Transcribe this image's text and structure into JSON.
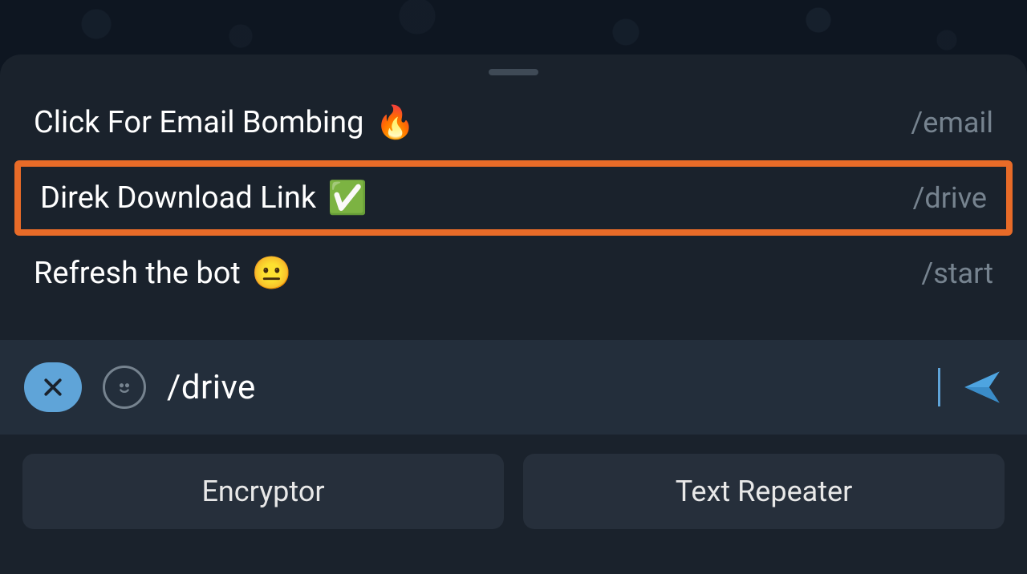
{
  "commands": [
    {
      "label": "Click For Email Bombing",
      "emoji": "🔥",
      "slash": "/email",
      "highlight": false
    },
    {
      "label": "Direk Download Link",
      "emoji": "✅",
      "slash": "/drive",
      "highlight": true
    },
    {
      "label": "Refresh the bot",
      "emoji": "😐",
      "slash": "/start",
      "highlight": false
    }
  ],
  "input": {
    "value": "/drive"
  },
  "buttons": {
    "left": "Encryptor",
    "right": "Text Repeater"
  }
}
